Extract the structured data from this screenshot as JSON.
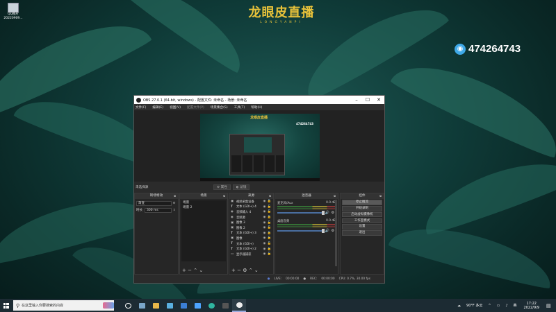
{
  "desktop": {
    "icon_label": "QQ图片",
    "icon_sublabel": "20220909...",
    "brand_title": "龙眼皮直播",
    "brand_subtitle": "LONGYANPI",
    "qq_number": "474264743"
  },
  "obs": {
    "title": "OBS 27.0.1 (64-bit, windows) - 配置文件: 未命名 - 场景: 未命名",
    "menu": [
      "文件(F)",
      "编辑(E)",
      "视图(V)",
      "配置文件(P)",
      "场景集合(S)",
      "工具(T)",
      "帮助(H)"
    ],
    "preview_title": "龙眼皮直播",
    "preview_qq": "474264743",
    "no_source_selected": "未选择源",
    "properties_btn": "属性",
    "filters_btn": "滤镜",
    "docks": {
      "filters": {
        "title": "转场特效",
        "fade": "渐变",
        "duration_label": "时长",
        "duration_value": "300 ms"
      },
      "scenes": {
        "title": "场景",
        "items": [
          "场景",
          "场景 2"
        ]
      },
      "sources": {
        "title": "来源",
        "items": [
          {
            "icon": "▣",
            "name": "视频采集设备"
          },
          {
            "icon": "T",
            "name": "文本 (GDI+) 4"
          },
          {
            "icon": "◉",
            "name": "音频输入 4"
          },
          {
            "icon": "◉",
            "name": "音频源"
          },
          {
            "icon": "▣",
            "name": "图像 3"
          },
          {
            "icon": "▣",
            "name": "图像 2"
          },
          {
            "icon": "T",
            "name": "文本 (GDI+) 3"
          },
          {
            "icon": "▣",
            "name": "图像"
          },
          {
            "icon": "T",
            "name": "文本 (GDI+)"
          },
          {
            "icon": "T",
            "name": "文本 (GDI+) 2"
          },
          {
            "icon": "▭",
            "name": "显示器捕获"
          }
        ]
      },
      "mixer": {
        "title": "混音器",
        "channels": [
          {
            "name": "桌面音频",
            "db": "0.0 dB"
          },
          {
            "name": "麦克风/Aux",
            "db": "0.0 dB"
          }
        ]
      },
      "controls": {
        "title": "控件",
        "buttons": [
          "停止推流",
          "开始录制",
          "启动虚拟摄像机",
          "工作室模式",
          "设置",
          "退出"
        ]
      }
    },
    "status": {
      "fps_label": "LIVE:",
      "live_time": "00:00:00",
      "rec_label": "REC:",
      "rec_time": "00:00:00",
      "cpu": "CPU: 0.7%, 30.00 fps"
    }
  },
  "taskbar": {
    "search_placeholder": "在这里输入你要搜索的内容",
    "weather": "90°F 多云",
    "lang": "英",
    "time": "17:22",
    "date": "2022/9/9"
  }
}
